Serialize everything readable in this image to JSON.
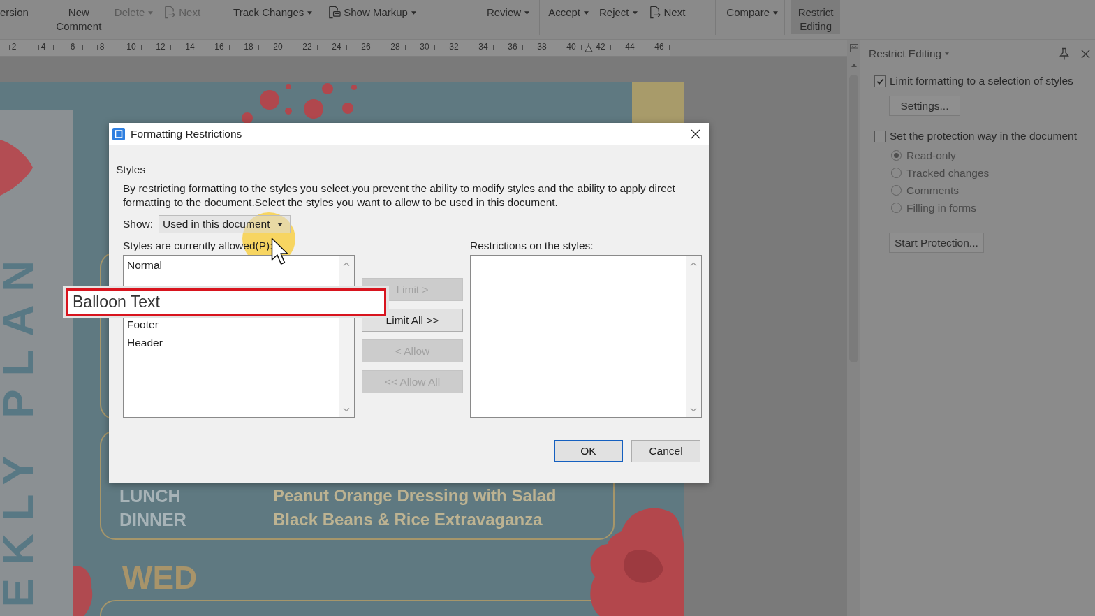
{
  "toolbar": {
    "groups": [
      {
        "items": [
          {
            "label": "ersion",
            "kind": "plain",
            "disabled": false,
            "selected": false
          },
          {
            "label": "New Comment",
            "kind": "large",
            "disabled": false,
            "selected": false
          },
          {
            "label": "Delete",
            "kind": "menu",
            "disabled": true,
            "selected": false
          },
          {
            "label": "Next",
            "kind": "next",
            "disabled": true,
            "selected": false
          }
        ]
      },
      {
        "items": [
          {
            "label": "Track Changes",
            "kind": "menu",
            "disabled": false,
            "selected": false
          },
          {
            "label": "Show Markup",
            "kind": "markup",
            "disabled": false,
            "selected": false
          }
        ]
      },
      {
        "items": [
          {
            "label": "Review",
            "kind": "menu",
            "disabled": false,
            "selected": false
          }
        ]
      },
      {
        "items": [
          {
            "label": "Accept",
            "kind": "menu",
            "disabled": false,
            "selected": false
          },
          {
            "label": "Reject",
            "kind": "menu",
            "disabled": false,
            "selected": false
          },
          {
            "label": "Next",
            "kind": "next",
            "disabled": false,
            "selected": false
          }
        ]
      },
      {
        "items": [
          {
            "label": "Compare",
            "kind": "menu",
            "disabled": false,
            "selected": false
          }
        ]
      },
      {
        "items": [
          {
            "label": "Restrict Editing",
            "kind": "large",
            "disabled": false,
            "selected": true
          }
        ]
      }
    ]
  },
  "ruler": {
    "numbers": [
      "2",
      "4",
      "6",
      "8",
      "10",
      "12",
      "14",
      "16",
      "18",
      "20",
      "22",
      "24",
      "26",
      "28",
      "30",
      "32",
      "34",
      "36",
      "38",
      "40",
      "42",
      "44",
      "46"
    ]
  },
  "document": {
    "side_title": "EKLY PLAN",
    "meals": [
      {
        "meal": "LUNCH",
        "dish": "Peanut Orange Dressing with Salad"
      },
      {
        "meal": "DINNER",
        "dish": "Black Beans & Rice Extravaganza"
      }
    ],
    "day": "WED"
  },
  "dialog": {
    "title": "Formatting Restrictions",
    "group_label": "Styles",
    "description": "By restricting formatting to the styles you select,you prevent the ability to modify styles and the ability to apply direct formatting to the document.Select the styles you want to allow to be used in this document.",
    "show_label": "Show:",
    "show_value": "Used in this document",
    "allowed_label": "Styles are currently allowed(P):",
    "allowed_styles": [
      "Normal",
      "Footer",
      "Header"
    ],
    "restrictions_label": "Restrictions on the styles:",
    "move_buttons": [
      {
        "label": "Limit >",
        "disabled": true
      },
      {
        "label": "Limit All >>",
        "disabled": false
      },
      {
        "label": "< Allow",
        "disabled": true
      },
      {
        "label": "<< Allow All",
        "disabled": true
      }
    ],
    "buttons": [
      {
        "label": "OK",
        "default": true
      },
      {
        "label": "Cancel",
        "default": false
      }
    ]
  },
  "zoom_callout": {
    "text": "Balloon Text"
  },
  "panel": {
    "title": "Restrict Editing",
    "sections": [
      {
        "kind": "checkbox",
        "label": "Limit formatting to a selection of styles",
        "checked": true
      },
      {
        "kind": "button",
        "label": "Settings..."
      },
      {
        "kind": "checkbox",
        "label": "Set the protection way in the document",
        "checked": false
      },
      {
        "kind": "radio-group",
        "disabled": true,
        "choices": [
          {
            "label": "Read-only",
            "selected": true
          },
          {
            "label": "Tracked changes",
            "selected": false
          },
          {
            "label": "Comments",
            "selected": false
          },
          {
            "label": "Filling in forms",
            "selected": false
          }
        ]
      },
      {
        "kind": "button",
        "label": "Start Protection..."
      }
    ]
  }
}
